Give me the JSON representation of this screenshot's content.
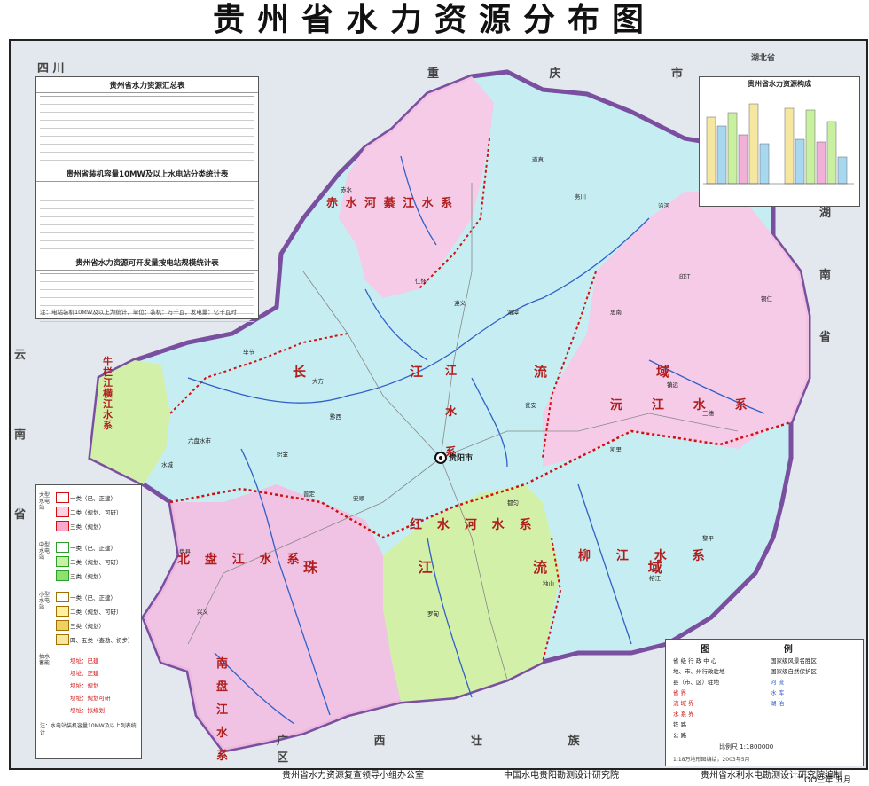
{
  "title": "贵州省水力资源分布图",
  "panels": {
    "summary_table_title": "贵州省水力资源汇总表",
    "hydro_stats_title": "贵州省装机容量10MW及以上水电站分类统计表",
    "development_title": "贵州省水力资源可开发量按电站规模统计表",
    "tables_note": "注：电站装机10MW及以上为统计，单位：装机：万千瓦，发电量：亿千瓦时",
    "composition_title": "贵州省水力资源构成"
  },
  "basins": {
    "chishui": "赤 水 河 綦 江 水 系",
    "niulan": "牛栏江横江水系",
    "wujiang": "长 江 乌 江 流 域",
    "wujiang_system": "江 水 系",
    "yuanjiang": "沅 江 水 系",
    "beipan": "北 盘 江 水 系",
    "hongshui": "红 水 河 水 系",
    "zhujiang": "珠 江 流 域",
    "liujiang": "柳 江 水 系",
    "nanpan": "南 盘 江 水 系",
    "changjiang_label": "长",
    "jiang_label": "江",
    "liu_label": "流",
    "yu_label": "域"
  },
  "provinces": {
    "sichuan": "四 川",
    "chongqing": "重 庆 市",
    "hubei": "湖北省",
    "hunan": "湖 南 省",
    "yunnan": "云 南 省",
    "guangxi": "广 西 壮 族 自 治 区"
  },
  "cities": [
    "贵阳市",
    "遵义",
    "毕节",
    "六盘水市",
    "安顺",
    "都匀",
    "凯里",
    "铜仁",
    "兴义",
    "赤水",
    "仁怀",
    "思南",
    "大方",
    "黔西",
    "织金",
    "普定",
    "水城",
    "盘县",
    "罗甸",
    "黎平",
    "榕江",
    "独山",
    "瓮安",
    "湄潭",
    "道真",
    "务川",
    "沿河",
    "印江",
    "镇远",
    "三穗"
  ],
  "capital": "贵阳市",
  "side_legend": {
    "groups": [
      "大型水电站",
      "中型水电站",
      "小型水电站",
      "抽水蓄能"
    ],
    "items": [
      "一类（已、正建）",
      "二类（规划、可研）",
      "三类（规划）",
      "一类（已、正建）",
      "二类（规划、可研）",
      "三类（规划）",
      "一类（已、正建）",
      "二类（规划、可研）",
      "三类（规划）",
      "四、五类（查勘、初步）",
      "坝址：已建",
      "坝址：正建",
      "坝址：规划",
      "坝址：规划可研",
      "坝址：拟规划"
    ],
    "note": "注：水电站装机容量10MW及以上列表统计"
  },
  "legend": {
    "title": "图 例",
    "items": [
      "省 级 行 政 中 心",
      "地、市、州行政驻地",
      "县（市、区）驻地",
      "省 界",
      "流 域 界",
      "水 系 界",
      "铁 路",
      "公 路",
      "国家级风景名胜区",
      "国家级自然保护区",
      "河 流",
      "水 库",
      "湖 泊"
    ],
    "scale": "比例尺 1:1800000",
    "note": "1:18万地形图编绘，2003年5月"
  },
  "footer": {
    "left": "贵州省水力资源复查领导小组办公室",
    "middle": "中国水电贵阳勘测设计研究院",
    "right": "贵州省水利水电勘测设计研究院编制",
    "date": "二OO三年  五月"
  },
  "colors": {
    "yangtze_basin": "#f8c8e6",
    "wujiang_basin": "#c6eef2",
    "pearl_green": "#d2f0a8",
    "pearl_pink": "#f2bfe2",
    "boundary_red": "#d01010",
    "river_blue": "#3060c8",
    "neighbor_gray": "#dde3ea"
  }
}
